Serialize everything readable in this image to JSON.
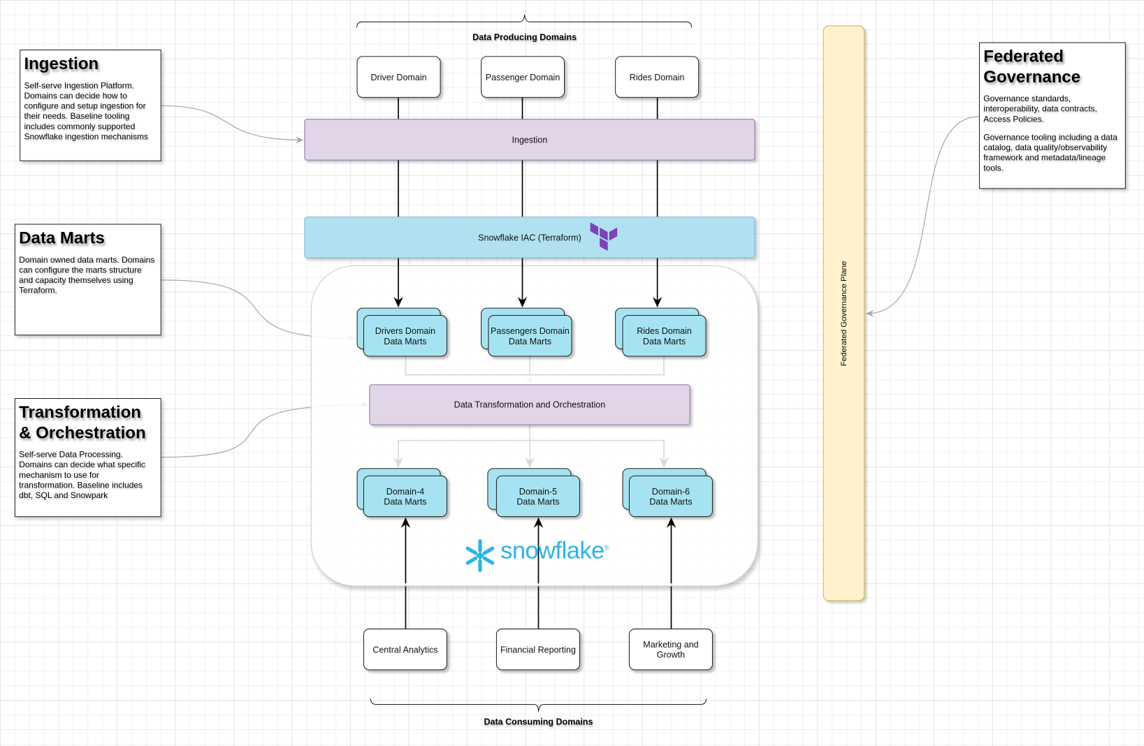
{
  "producing": {
    "label": "Data Producing Domains",
    "domains": [
      "Driver Domain",
      "Passenger Domain",
      "Rides Domain"
    ]
  },
  "layers": {
    "ingestion": "Ingestion",
    "iac": "Snowflake IAC (Terraform)",
    "transformation": "Data Transformation and Orchestration"
  },
  "marts_top": [
    [
      "Drivers Domain",
      "Data Marts"
    ],
    [
      "Passengers Domain",
      "Data Marts"
    ],
    [
      "Rides Domain",
      "Data Marts"
    ]
  ],
  "marts_bottom": [
    [
      "Domain-4",
      "Data Marts"
    ],
    [
      "Domain-5",
      "Data Marts"
    ],
    [
      "Domain-6",
      "Data Marts"
    ]
  ],
  "consuming": {
    "label": "Data Consuming Domains",
    "domains": [
      "Central Analytics",
      "Financial Reporting",
      [
        "Marketing and",
        "Growth"
      ]
    ]
  },
  "logo": {
    "snowflake": "snowflake",
    "registered": "®"
  },
  "governance_plane": "Federated Governance Plane",
  "notes": {
    "ingestion": {
      "title": "Ingestion",
      "body": [
        "Self-serve Ingestion Platform. Domains can decide how to configure and setup ingestion for their needs. Baseline tooling includes commonly supported Snowflake ingestion mechanisms"
      ]
    },
    "marts": {
      "title": "Data Marts",
      "body": [
        "Domain owned data marts. Domains can configure the marts structure and capacity themselves using Terraform."
      ]
    },
    "transformation": {
      "title": "Transformation & Orchestration",
      "body": [
        "Self-serve Data Processing. Domains can decide what specific mechanism to use for transformation. Baseline includes dbt, SQL and Snowpark"
      ]
    },
    "governance": {
      "title": "Federated Governance",
      "body": [
        "Governance standards, interoperability, data contracts, Access Policies.",
        "Governance tooling including a data catalog, data quality/observability framework and metadata/lineage tools."
      ]
    }
  },
  "colors": {
    "ingestion": "#e1d5e7",
    "iac": "#b1e1f0",
    "mart": "#a6e3f2",
    "plane": "#fff2cc",
    "terraform": "#7b42bc",
    "snowflake": "#29b5e8"
  }
}
